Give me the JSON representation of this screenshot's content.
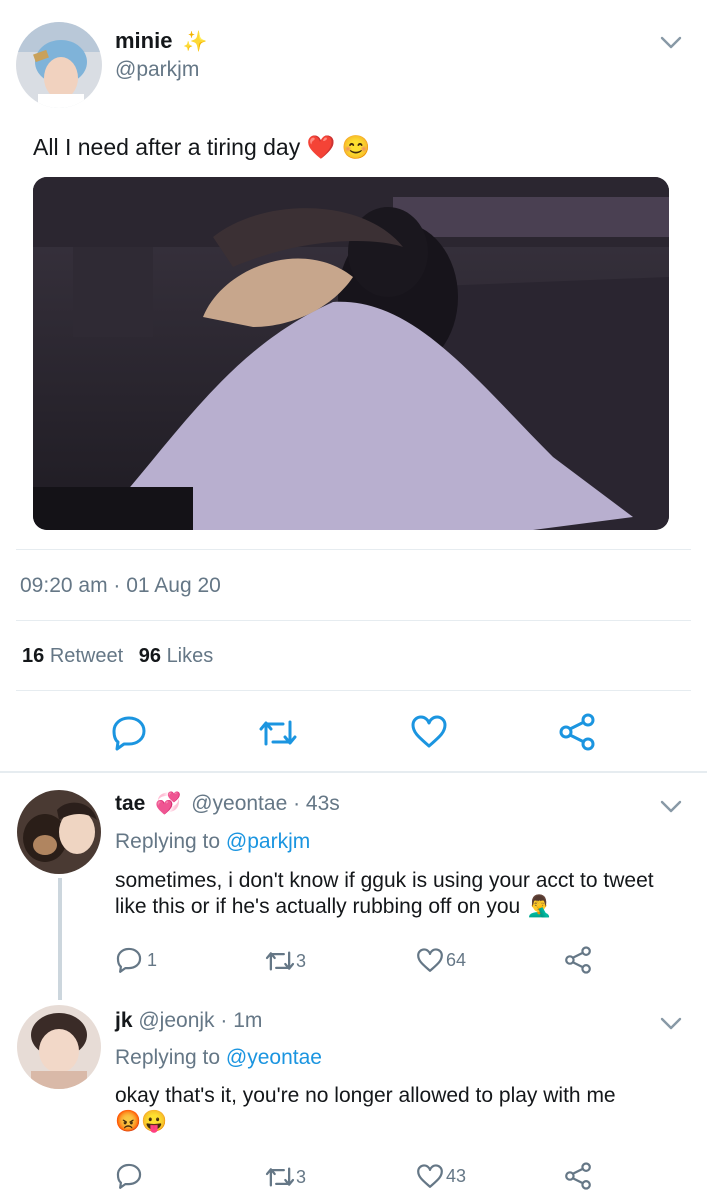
{
  "main_tweet": {
    "display_name": "minie",
    "display_emoji": "✨",
    "handle": "@parkjm",
    "text": "All I need after a tiring day",
    "text_emojis": [
      "❤️",
      "😊"
    ],
    "timestamp": "09:20 am · 01 Aug 20",
    "retweet_count": "16",
    "retweet_label": "Retweet",
    "like_count": "96",
    "like_label": "Likes"
  },
  "replies": [
    {
      "display_name": "tae",
      "display_emoji": "💞",
      "handle": "@yeontae",
      "time": "· 43s",
      "replying_prefix": "Replying to",
      "replying_to": "@parkjm",
      "text": "sometimes, i don't know if gguk is using your acct to tweet like this or if he's actually rubbing off on you",
      "text_emojis": [
        "🤦‍♂️"
      ],
      "reply_count": "1",
      "retweet_count": "3",
      "like_count": "64"
    },
    {
      "display_name": "jk",
      "display_emoji": "",
      "handle": "@jeonjk",
      "time": "· 1m",
      "replying_prefix": "Replying to",
      "replying_to": "@yeontae",
      "text": "okay that's it, you're no longer allowed to play with me",
      "text_emojis": [
        "😡",
        "😛"
      ],
      "reply_count": "",
      "retweet_count": "3",
      "like_count": "43"
    }
  ],
  "colors": {
    "accent": "#1b95e0",
    "muted": "#657786",
    "divider": "#e6ecf0",
    "text": "#14171a"
  }
}
